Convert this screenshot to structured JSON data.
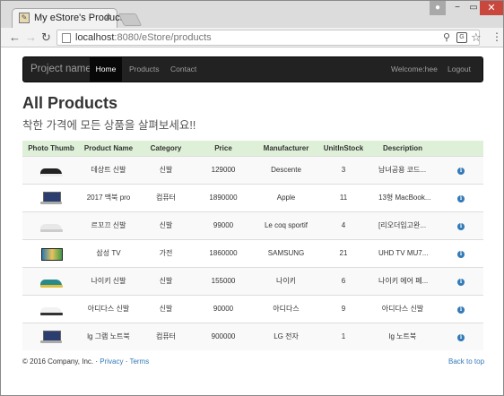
{
  "browser": {
    "tab_title": "My eStore's Products",
    "tab_close": "×",
    "url_host": "localhost",
    "url_rest": ":8080/eStore/products",
    "window_buttons": {
      "minimize": "−",
      "maximize": "▭",
      "close": "✕"
    }
  },
  "navbar": {
    "brand": "Project name",
    "links": [
      "Home",
      "Products",
      "Contact"
    ],
    "active": "Home",
    "welcome": "Welcome:hee",
    "logout": "Logout"
  },
  "header": {
    "title": "All Products",
    "subtitle": "착한 가격에 모든 상품을 살펴보세요!!"
  },
  "table": {
    "columns": [
      "Photo Thumb",
      "Product Name",
      "Category",
      "Price",
      "Manufacturer",
      "UnitInStock",
      "Description",
      ""
    ],
    "rows": [
      {
        "name": "데상트 신발",
        "category": "신발",
        "price": "129000",
        "manufacturer": "Descente",
        "stock": "3",
        "description": "남녀공용 코드...",
        "thumb": "shoe-black"
      },
      {
        "name": "2017 맥북 pro",
        "category": "컴퓨터",
        "price": "1890000",
        "manufacturer": "Apple",
        "stock": "11",
        "description": "13형 MacBook...",
        "thumb": "laptop"
      },
      {
        "name": "르꼬끄 신발",
        "category": "신발",
        "price": "99000",
        "manufacturer": "Le coq sportif",
        "stock": "4",
        "description": "[리오더입고완...",
        "thumb": "shoe-white"
      },
      {
        "name": "삼성 TV",
        "category": "가전",
        "price": "1860000",
        "manufacturer": "SAMSUNG",
        "stock": "21",
        "description": "UHD TV MU7...",
        "thumb": "tv"
      },
      {
        "name": "나이키 신발",
        "category": "신발",
        "price": "155000",
        "manufacturer": "나이키",
        "stock": "6",
        "description": "나이키 에어 페...",
        "thumb": "shoe-teal"
      },
      {
        "name": "아디다스 신발",
        "category": "신발",
        "price": "90000",
        "manufacturer": "아디다스",
        "stock": "9",
        "description": "아디다스 신발",
        "thumb": "shoe-adidas"
      },
      {
        "name": "lg 그램 노트북",
        "category": "컴퓨터",
        "price": "900000",
        "manufacturer": "LG 전자",
        "stock": "1",
        "description": "lg 노트북",
        "thumb": "laptop-lg"
      }
    ]
  },
  "footer": {
    "copyright": "© 2016 Company, Inc. · ",
    "privacy": "Privacy",
    "separator": " · ",
    "terms": "Terms",
    "back_to_top": "Back to top"
  },
  "colors": {
    "navbar": "#222222",
    "header_row": "#dff0d8",
    "link": "#337ab7",
    "info_icon": "#337ab7"
  },
  "icons": [
    "back-icon",
    "forward-icon",
    "reload-icon",
    "page-icon",
    "zoom-icon",
    "translate-icon",
    "star-icon",
    "menu-icon",
    "info-icon"
  ]
}
